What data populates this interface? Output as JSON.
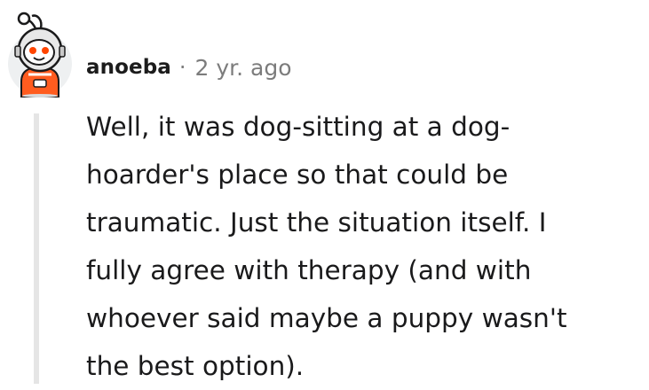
{
  "comment": {
    "author": "anoeba",
    "separator": "·",
    "timestamp": "2 yr. ago",
    "body_lines": [
      "Well, it was dog-sitting at a dog-",
      "hoarder's place so that could be",
      "traumatic. Just the situation itself. I",
      "fully agree with therapy (and with",
      "whoever said maybe a puppy wasn't",
      "the best option)."
    ]
  },
  "avatar": {
    "icon": "reddit-snoo-astronaut-avatar",
    "colors": {
      "helmet": "#e8e8e8",
      "visor": "#1a1a1b",
      "eye": "#ff4500",
      "suit": "#ff5c1f",
      "background": "#eef0f1"
    }
  },
  "colors": {
    "text": "#1a1a1b",
    "meta": "#7c7c7c",
    "thread_line": "#e5e5e5"
  }
}
